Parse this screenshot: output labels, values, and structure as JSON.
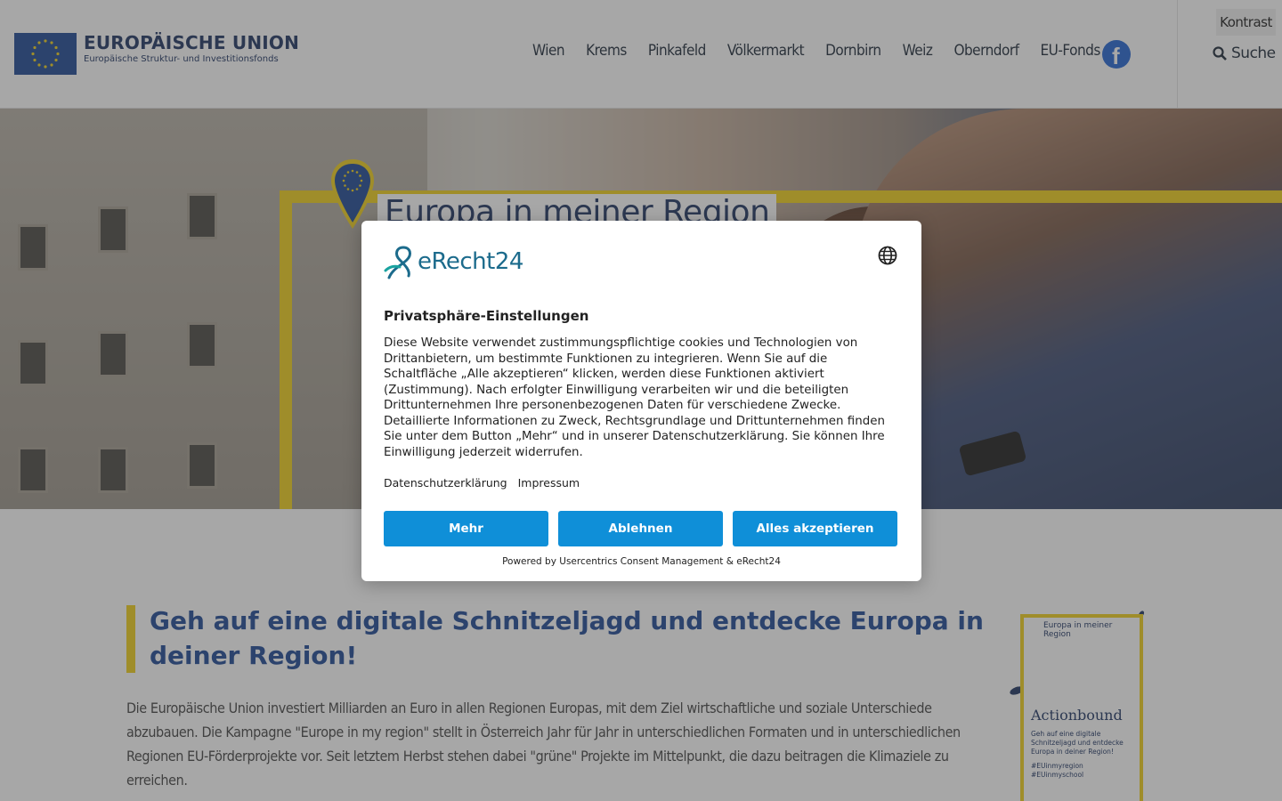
{
  "header": {
    "logo_title": "EUROPÄISCHE UNION",
    "logo_subtitle": "Europäische Struktur- und Investitionsfonds",
    "nav": [
      "Wien",
      "Krems",
      "Pinkafeld",
      "Völkermarkt",
      "Dornbirn",
      "Weiz",
      "Oberndorf",
      "EU-Fonds"
    ],
    "kontrast_label": "Kontrast",
    "search_label": "Suche",
    "icons": {
      "facebook": "facebook-icon",
      "search": "search-icon"
    }
  },
  "hero": {
    "title": "Europa in meiner Region"
  },
  "content": {
    "title": "Geh auf eine digitale Schnitzeljagd und entdecke Europa in dei­ner Region!",
    "text": "Die Europäische Union investiert Milliarden an Euro in allen Regionen Europas, mit dem Ziel wirtschaftliche und soziale Unterschiede abzubauen. Die Kampagne \"Europe in my region\" stellt in Österreich Jahr für Jahr in unterschiedlichen Formaten und in unterschiedlichen Regionen EU-Förderprojekte vor. Seit letztem Herbst stehen dabei  \"grüne\" Projekte im Mittelpunkt, die dazu beitragen die Klimaziele zu erreichen."
  },
  "poster": {
    "header": "Europa in meiner Region",
    "title": "Actionbound",
    "text": "Geh auf eine digitale Schnitzeljagd und entdecke Europa in deiner Region!",
    "tag1": "#EUinmyregion",
    "tag2": "#EUinmyschool"
  },
  "modal": {
    "brand": "eRecht24",
    "title": "Privatsphäre-Einstellungen",
    "text": "Diese Website verwendet zustimmungspflichtige cookies und Technologien von Drittanbietern, um bestimmte Funktionen zu integrieren. Wenn Sie auf die Schaltfläche „Alle akzeptieren“ klicken, werden diese Funktionen aktiviert (Zustimmung). Nach erfolgter Einwilligung verarbeiten wir und die beteiligten Drittunternehmen Ihre personenbezogenen Daten für verschiedene Zwecke. Detaillierte Informationen zu Zweck, Rechtsgrundlage und Drittunternehmen finden Sie unter dem Button „Mehr“ und in unserer Datenschutzerklärung. Sie können Ihre Einwilligung jederzeit widerrufen.",
    "link_privacy": "Datenschutzerklärung",
    "link_imprint": "Impressum",
    "btn_more": "Mehr",
    "btn_decline": "Ablehnen",
    "btn_accept": "Alles akzeptieren",
    "powered": "Powered by Usercentrics Consent Management & eRecht24",
    "brand_color": "#1c6b8c",
    "button_color": "#0f8fd8"
  },
  "colors": {
    "eu_blue": "#1f4a95",
    "eu_yellow": "#f1cf1c"
  }
}
